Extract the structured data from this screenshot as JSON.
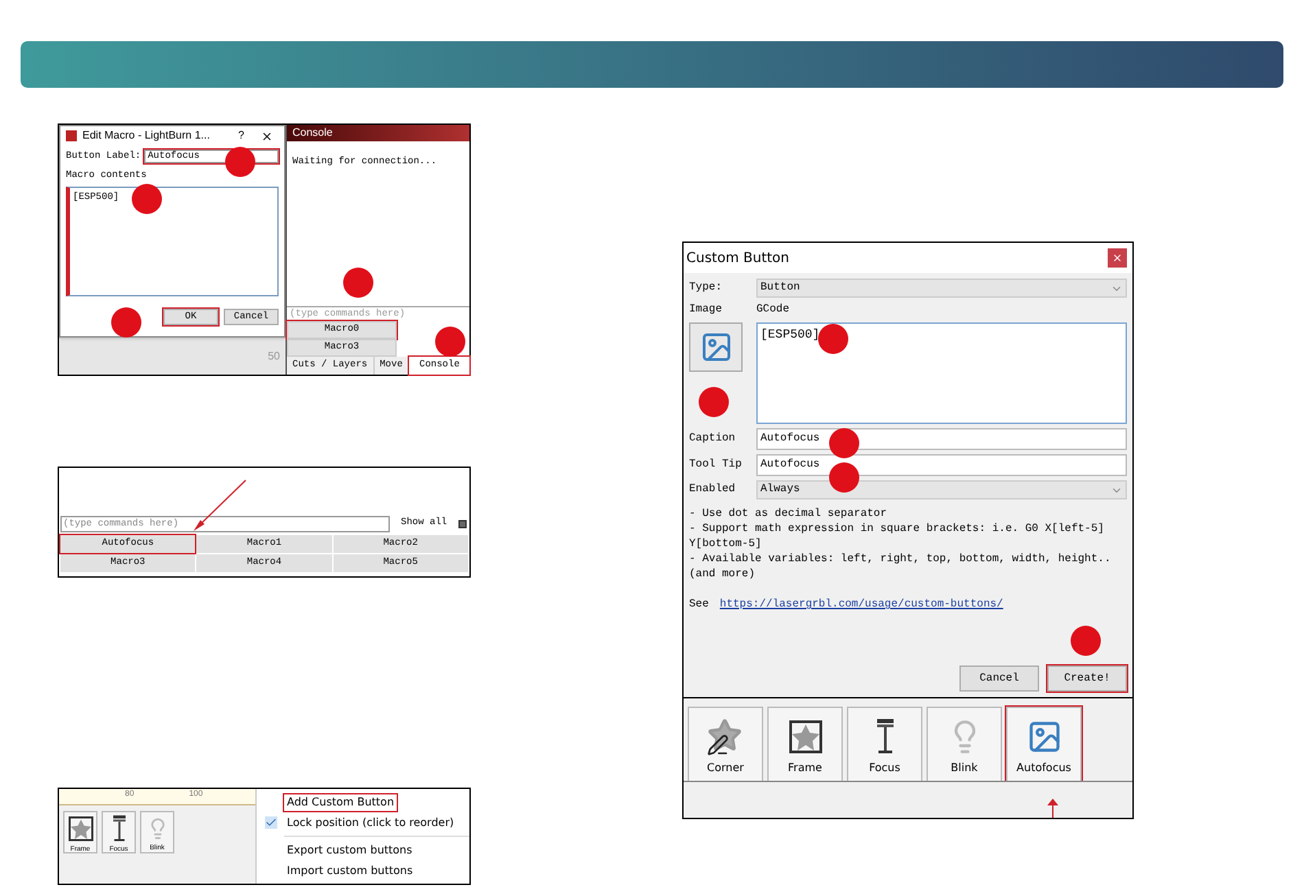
{
  "edit_macro_panel": {
    "dialog": {
      "title": "Edit Macro - LightBurn 1...",
      "help": "?",
      "button_label": {
        "label": "Button Label:",
        "value": "Autofocus",
        "highlighted": true
      },
      "macro_contents": {
        "label": "Macro contents",
        "value": "[ESP500]",
        "highlighted": true
      },
      "buttons": [
        {
          "label": "OK",
          "highlighted": true
        },
        {
          "label": "Cancel",
          "highlighted": false
        }
      ]
    },
    "ruler_value": "50",
    "console": {
      "title": "Console",
      "output": "Waiting for connection...",
      "command_placeholder": "(type commands here)",
      "macro_buttons": [
        {
          "label": "Macro0",
          "highlighted": true
        },
        {
          "label": "Macro3",
          "highlighted": false
        }
      ],
      "tabs": [
        {
          "label": "Cuts / Layers",
          "selected": false
        },
        {
          "label": "Move",
          "selected": false
        },
        {
          "label": "Console",
          "selected": true
        }
      ]
    }
  },
  "console_panel": {
    "command_placeholder": "(type commands here)",
    "show_all": "Show all",
    "show_all_checked": true,
    "macro_buttons": [
      {
        "label": "Autofocus",
        "highlighted": true
      },
      {
        "label": "Macro1",
        "highlighted": false
      },
      {
        "label": "Macro2",
        "highlighted": false
      },
      {
        "label": "Macro3",
        "highlighted": false
      },
      {
        "label": "Macro4",
        "highlighted": false
      },
      {
        "label": "Macro5",
        "highlighted": false
      }
    ]
  },
  "context_menu_panel": {
    "ruler": [
      "80",
      "100"
    ],
    "tools": [
      "Frame",
      "Focus",
      "Blink"
    ],
    "menu": [
      {
        "label": "Add Custom Button",
        "checked": false,
        "highlighted": true
      },
      {
        "label": "Lock position (click to reorder)",
        "checked": true,
        "highlighted": false
      },
      {
        "label": "Export custom buttons",
        "checked": false,
        "highlighted": false
      },
      {
        "label": "Import custom buttons",
        "checked": false,
        "highlighted": false
      }
    ]
  },
  "custom_button_dialog": {
    "title": "Custom Button",
    "type": {
      "label": "Type:",
      "value": "Button"
    },
    "image_label": "Image",
    "gcode_label": "GCode",
    "gcode": "[ESP500]",
    "caption": {
      "label": "Caption",
      "value": "Autofocus"
    },
    "tool_tip": {
      "label": "Tool Tip",
      "value": "Autofocus"
    },
    "enabled": {
      "label": "Enabled",
      "value": "Always"
    },
    "help_lines": [
      "- Use dot as decimal separator",
      "- Support math expression in square brackets: i.e. G0 X[left-5] Y[bottom-5]",
      "- Available variables: left, right, top, bottom, width, height.. (and more)"
    ],
    "see": "See",
    "link": "https://lasergrbl.com/usage/custom-buttons/",
    "buttons": [
      {
        "label": "Cancel",
        "highlighted": false
      },
      {
        "label": "Create!",
        "highlighted": true
      }
    ],
    "tools": [
      {
        "label": "Corner",
        "highlighted": false
      },
      {
        "label": "Frame",
        "highlighted": false
      },
      {
        "label": "Focus",
        "highlighted": false
      },
      {
        "label": "Blink",
        "highlighted": false
      },
      {
        "label": "Autofocus",
        "highlighted": true
      }
    ]
  }
}
